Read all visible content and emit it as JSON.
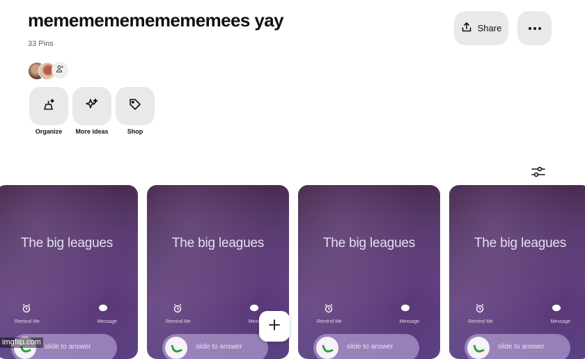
{
  "board": {
    "title": "memememememememees yay",
    "pin_count": "33 Pins"
  },
  "header_actions": {
    "share_label": "Share",
    "share_icon": "upload-icon",
    "more_icon": "more-horizontal-icon"
  },
  "collaborators": {
    "avatars": [
      "avatar",
      "avatar"
    ],
    "add_icon": "add-person-icon"
  },
  "tools": [
    {
      "label": "Organize",
      "icon": "broom-sparkle-icon"
    },
    {
      "label": "More ideas",
      "icon": "sparkles-icon"
    },
    {
      "label": "Shop",
      "icon": "tag-icon"
    }
  ],
  "filter_icon": "sliders-icon",
  "pins": [
    {
      "text": "The big leagues",
      "left_caption": "Remind Me",
      "right_caption": "Message",
      "slide_text": "slide to answer"
    },
    {
      "text": "The big leagues",
      "left_caption": "Remind Me",
      "right_caption": "Message",
      "slide_text": "slide to answer"
    },
    {
      "text": "The big leagues",
      "left_caption": "Remind Me",
      "right_caption": "Message",
      "slide_text": "slide to answer"
    },
    {
      "text": "The big leagues",
      "left_caption": "Remind Me",
      "right_caption": "Message",
      "slide_text": "slide to answer"
    }
  ],
  "fab_icon": "plus-icon",
  "watermark": "imgflip.com"
}
